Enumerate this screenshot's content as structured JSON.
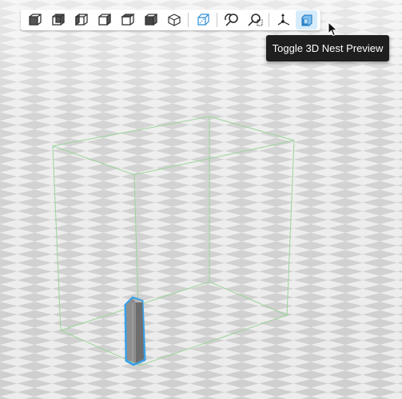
{
  "toolbar": {
    "buttons": [
      {
        "icon": "view-front-icon",
        "label": "Front view"
      },
      {
        "icon": "view-back-icon",
        "label": "Back view"
      },
      {
        "icon": "view-left-icon",
        "label": "Left view"
      },
      {
        "icon": "view-right-icon",
        "label": "Right view"
      },
      {
        "icon": "view-top-icon",
        "label": "Top view"
      },
      {
        "icon": "view-bottom-icon",
        "label": "Bottom view"
      },
      {
        "icon": "view-iso-icon",
        "label": "Isometric view"
      },
      {
        "icon": "view-perspective-icon",
        "label": "Perspective toggle",
        "active": true
      },
      {
        "icon": "zoom-to-fit-icon",
        "label": "Zoom to fit"
      },
      {
        "icon": "zoom-selection-icon",
        "label": "Zoom to selection"
      },
      {
        "icon": "axes-icon",
        "label": "Show axes"
      },
      {
        "icon": "nest-preview-icon",
        "label": "Toggle 3D Nest Preview",
        "active": true
      }
    ]
  },
  "tooltip": {
    "text": "Toggle 3D Nest Preview"
  },
  "colors": {
    "floor_light": "#ececec",
    "floor_dark": "#cfcfcf",
    "build_volume": "#9bd49b",
    "model_gray": "#8d8d8d",
    "selection": "#3aa0e8"
  }
}
